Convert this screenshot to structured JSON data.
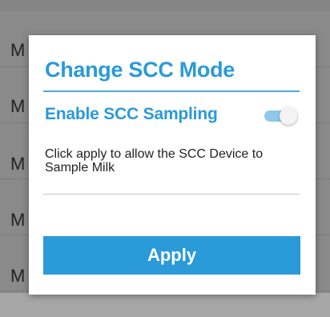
{
  "background": {
    "rows": [
      {
        "letter": "M"
      },
      {
        "letter": "M"
      },
      {
        "letter": "M"
      },
      {
        "letter": "M"
      },
      {
        "letter": "M"
      }
    ]
  },
  "dialog": {
    "title": "Change SCC Mode",
    "toggle": {
      "label": "Enable SCC Sampling",
      "checked": true
    },
    "description": "Click apply to allow the SCC Device to Sample Milk",
    "apply_label": "Apply"
  },
  "colors": {
    "accent": "#2a9ad8",
    "switch_track": "#8ec9ea",
    "overlay": "#8a8a8a"
  }
}
